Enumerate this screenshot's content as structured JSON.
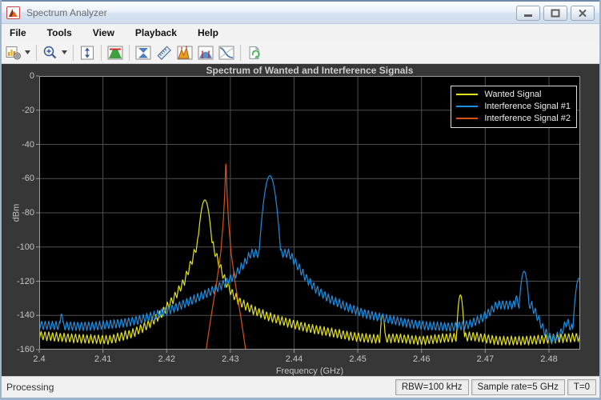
{
  "window": {
    "title": "Spectrum Analyzer"
  },
  "menu": {
    "items": [
      "File",
      "Tools",
      "View",
      "Playback",
      "Help"
    ]
  },
  "toolbar": {
    "icons": [
      "export-config",
      "zoom-in",
      "fit-to-view",
      "spectrum-settings",
      "spectral-mask",
      "cursor-measurements",
      "peak-finder",
      "channel-measurements",
      "distortion-measurements",
      "snapshot"
    ]
  },
  "status_bar": {
    "left": "Processing",
    "rbw": "RBW=100 kHz",
    "sample_rate": "Sample rate=5 GHz",
    "time": "T=0"
  },
  "chart_data": {
    "type": "line",
    "title": "Spectrum of Wanted and Interference Signals",
    "xlabel": "Frequency (GHz)",
    "ylabel": "dBm",
    "xlim": [
      2.4,
      2.4849
    ],
    "ylim": [
      -160,
      0
    ],
    "xticks": [
      2.4,
      2.41,
      2.42,
      2.43,
      2.44,
      2.45,
      2.46,
      2.47,
      2.48
    ],
    "yticks": [
      0,
      -20,
      -40,
      -60,
      -80,
      -100,
      -120,
      -140,
      -160
    ],
    "grid": true,
    "legend_position": "top-right",
    "plot_bg": "#000000",
    "grid_color": "#4f4f4f",
    "axis_color": "#9a9a9a",
    "text_color": "#c4c4c4",
    "series": [
      {
        "name": "Wanted Signal",
        "color": "#e3e11c",
        "peak_summary": {
          "center_ghz": 2.426,
          "peak_dbm": -72.5
        },
        "envelope_dbm": [
          [
            2.4,
            -149
          ],
          [
            2.403,
            -150
          ],
          [
            2.407,
            -151
          ],
          [
            2.411,
            -151.5
          ],
          [
            2.4145,
            -148
          ],
          [
            2.417,
            -143
          ],
          [
            2.419,
            -137
          ],
          [
            2.421,
            -128
          ],
          [
            2.4228,
            -117
          ],
          [
            2.4238,
            -107
          ],
          [
            2.4246,
            -98
          ],
          [
            2.4252,
            -90
          ],
          [
            2.4268,
            -90
          ],
          [
            2.4274,
            -98
          ],
          [
            2.4282,
            -107
          ],
          [
            2.4292,
            -117
          ],
          [
            2.4302,
            -124
          ],
          [
            2.4315,
            -129.5
          ],
          [
            2.4335,
            -134
          ],
          [
            2.436,
            -138
          ],
          [
            2.439,
            -141.5
          ],
          [
            2.442,
            -144.5
          ],
          [
            2.4455,
            -147
          ],
          [
            2.449,
            -149.5
          ],
          [
            2.4525,
            -151
          ],
          [
            2.456,
            -150.5
          ],
          [
            2.46,
            -152
          ],
          [
            2.4635,
            -150.5
          ],
          [
            2.468,
            -149.5
          ],
          [
            2.472,
            -152
          ],
          [
            2.476,
            -152
          ],
          [
            2.48,
            -151
          ],
          [
            2.4849,
            -150
          ]
        ],
        "peaks_dbm": [
          [
            2.426,
            -72.5,
            0.0014
          ],
          [
            2.4539,
            -139.5,
            0.0007
          ],
          [
            2.4661,
            -128.0,
            0.0008
          ]
        ],
        "ripple": {
          "period_ghz": 0.0006,
          "depth_db": 5.5,
          "phase": 0.0
        }
      },
      {
        "name": "Interference Signal #1",
        "color": "#1e8de0",
        "peak_summary": {
          "center_ghz": 2.4362,
          "peak_dbm": -58.3
        },
        "envelope_dbm": [
          [
            2.4,
            -143
          ],
          [
            2.405,
            -143.5
          ],
          [
            2.409,
            -143.5
          ],
          [
            2.4125,
            -142
          ],
          [
            2.4155,
            -140
          ],
          [
            2.418,
            -137.5
          ],
          [
            2.4205,
            -134
          ],
          [
            2.423,
            -130
          ],
          [
            2.4255,
            -126
          ],
          [
            2.4275,
            -122
          ],
          [
            2.4295,
            -117.5
          ],
          [
            2.431,
            -112.5
          ],
          [
            2.4322,
            -107
          ],
          [
            2.4332,
            -101
          ],
          [
            2.4392,
            -101
          ],
          [
            2.4405,
            -108
          ],
          [
            2.442,
            -116
          ],
          [
            2.4435,
            -122
          ],
          [
            2.4455,
            -127.5
          ],
          [
            2.448,
            -132
          ],
          [
            2.451,
            -136
          ],
          [
            2.454,
            -139
          ],
          [
            2.4575,
            -141.5
          ],
          [
            2.461,
            -143.5
          ],
          [
            2.4645,
            -144
          ],
          [
            2.4675,
            -142.5
          ],
          [
            2.4695,
            -139
          ],
          [
            2.4708,
            -135
          ],
          [
            2.4718,
            -131
          ],
          [
            2.4772,
            -131
          ],
          [
            2.4782,
            -138
          ],
          [
            2.4792,
            -146
          ],
          [
            2.4805,
            -151.5
          ],
          [
            2.4818,
            -148
          ],
          [
            2.4828,
            -141
          ],
          [
            2.4838,
            -146
          ],
          [
            2.4849,
            -150
          ]
        ],
        "peaks_dbm": [
          [
            2.4362,
            -58.3,
            0.0016
          ],
          [
            2.4035,
            -139.2,
            0.0006
          ],
          [
            2.4749,
            -128.5,
            0.00055
          ],
          [
            2.4761,
            -114.2,
            0.0011
          ],
          [
            2.4847,
            -118.3,
            0.0011
          ]
        ],
        "ripple": {
          "period_ghz": 0.00057,
          "depth_db": 5.5,
          "phase": 0.35
        }
      },
      {
        "name": "Interference Signal #2",
        "color": "#d95319",
        "peak_summary": {
          "center_ghz": 2.4293,
          "peak_dbm": -51.5
        },
        "envelope_dbm": [
          [
            2.4,
            -172
          ],
          [
            2.4252,
            -172
          ],
          [
            2.4262,
            -160
          ],
          [
            2.427,
            -140
          ],
          [
            2.4278,
            -122
          ],
          [
            2.4285,
            -103
          ],
          [
            2.4289,
            -84
          ],
          [
            2.4291,
            -70
          ],
          [
            2.4292,
            -60
          ],
          [
            2.42925,
            -53.5
          ],
          [
            2.4293,
            -51.5
          ],
          [
            2.42935,
            -53.5
          ],
          [
            2.4294,
            -60
          ],
          [
            2.4295,
            -70
          ],
          [
            2.4297,
            -84
          ],
          [
            2.4301,
            -103
          ],
          [
            2.4308,
            -122
          ],
          [
            2.4316,
            -140
          ],
          [
            2.4324,
            -160
          ],
          [
            2.4334,
            -172
          ],
          [
            2.4849,
            -172
          ]
        ],
        "peaks_dbm": [],
        "ripple": {
          "period_ghz": 0.001,
          "depth_db": 0,
          "phase": 0
        }
      }
    ]
  }
}
